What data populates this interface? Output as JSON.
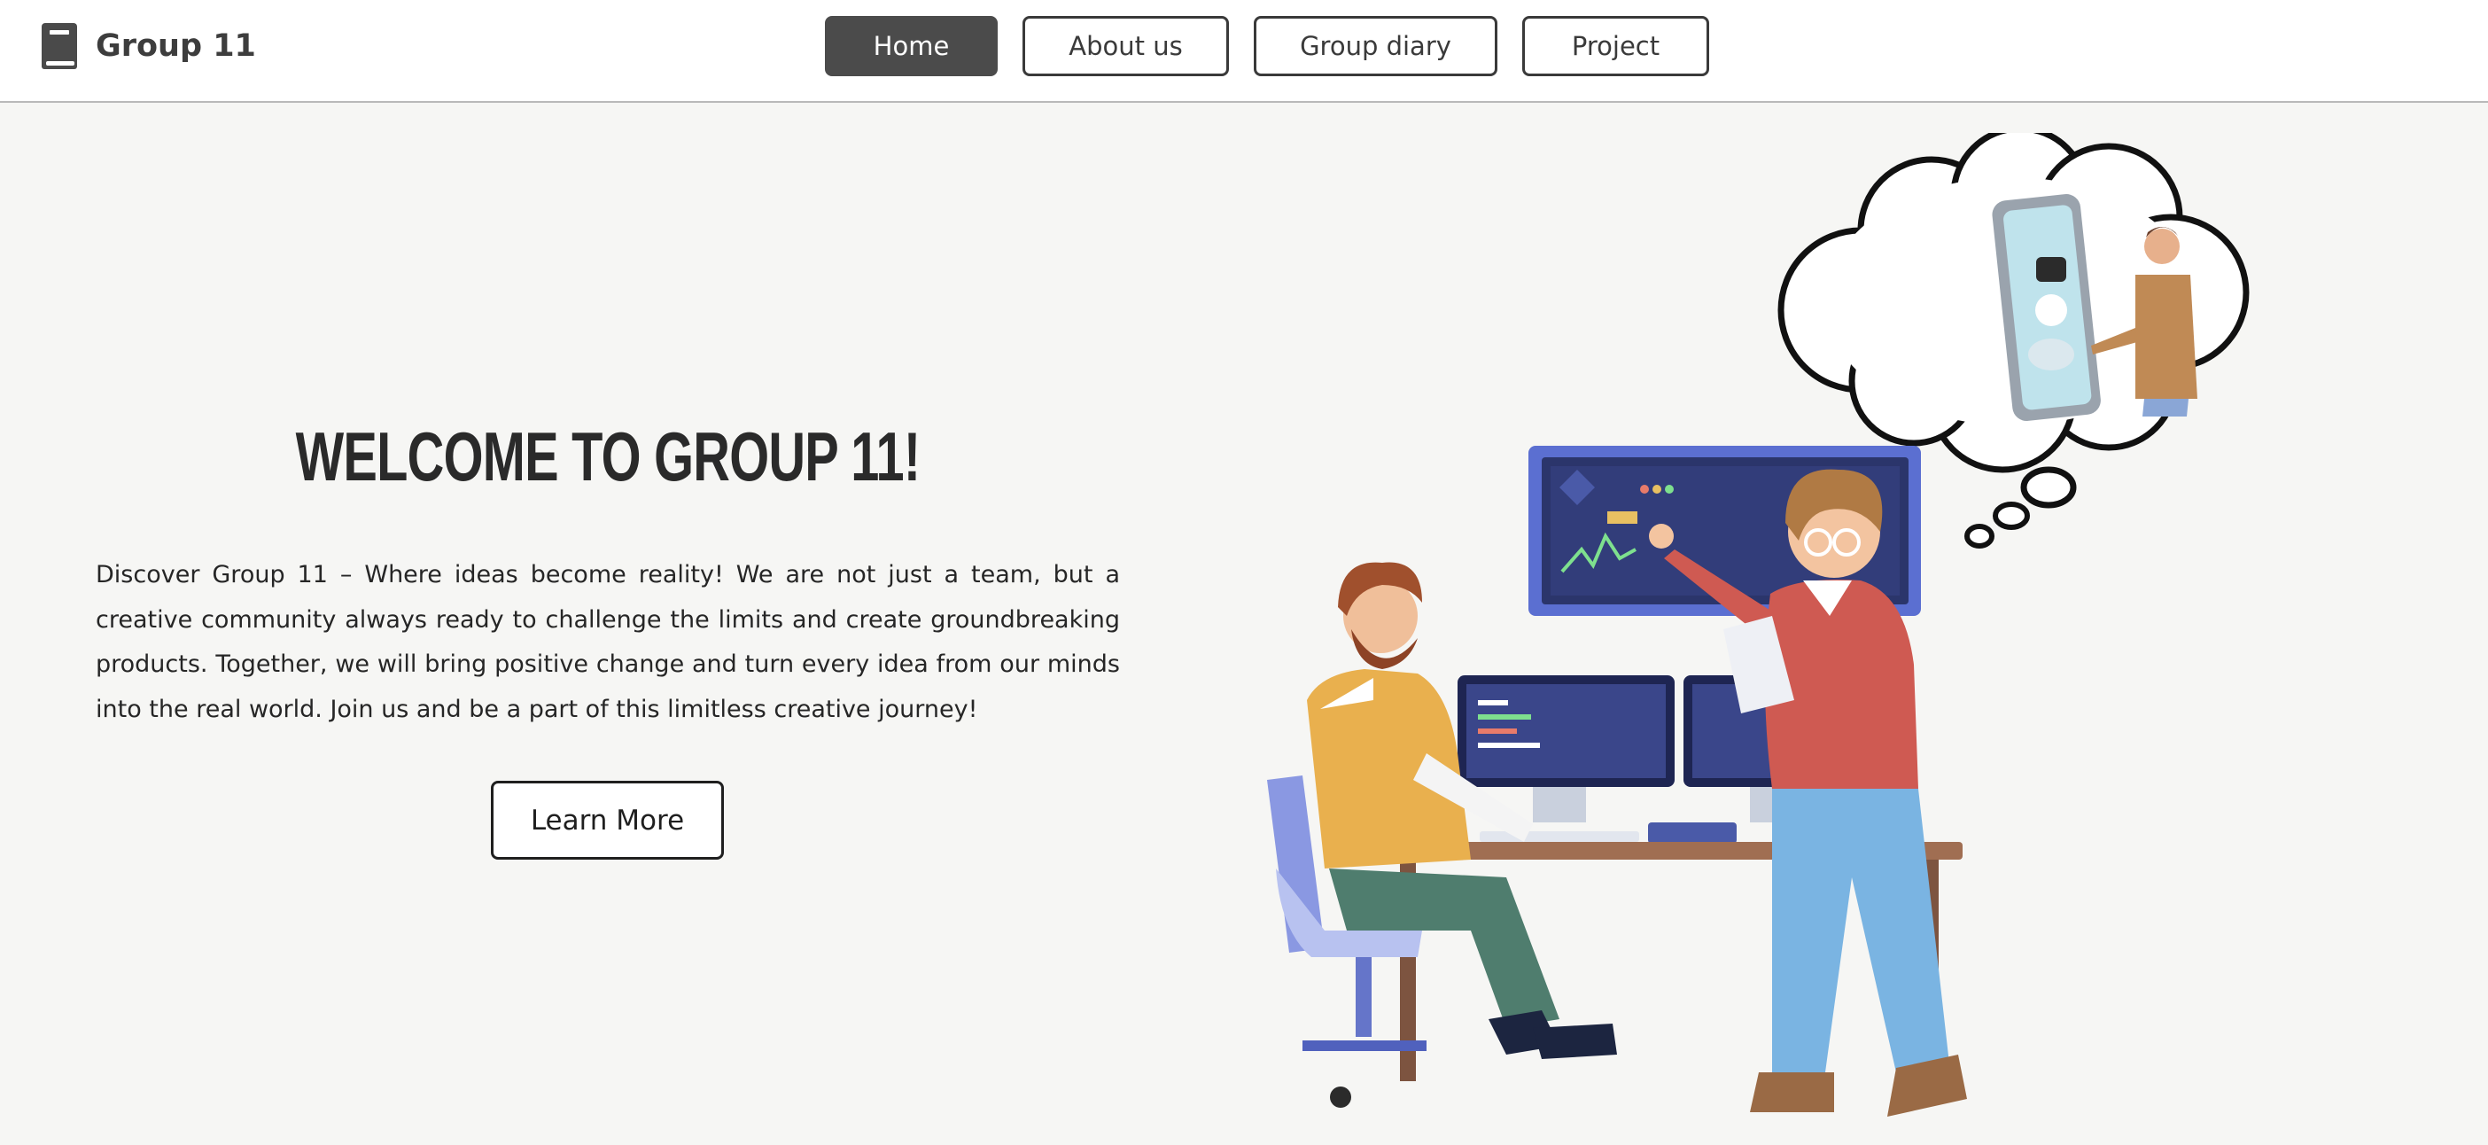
{
  "header": {
    "brand": {
      "name": "Group 11",
      "icon": "book-icon"
    },
    "nav": [
      {
        "label": "Home",
        "active": true
      },
      {
        "label": "About us",
        "active": false
      },
      {
        "label": "Group diary",
        "active": false
      },
      {
        "label": "Project",
        "active": false
      }
    ]
  },
  "hero": {
    "title": "WELCOME TO GROUP 11!",
    "description": "Discover Group 11 – Where ideas become reality! We are not just a team, but a creative community always ready to challenge the limits and create groundbreaking products. Together, we will bring positive change and turn every idea from our minds into the real world. Join us and be a part of this limitless creative journey!",
    "cta_label": "Learn More"
  },
  "colors": {
    "page_background": "#f6f6f4",
    "header_background": "#ffffff",
    "active_nav": "#4b4b4b",
    "text": "#2b2b2b"
  }
}
